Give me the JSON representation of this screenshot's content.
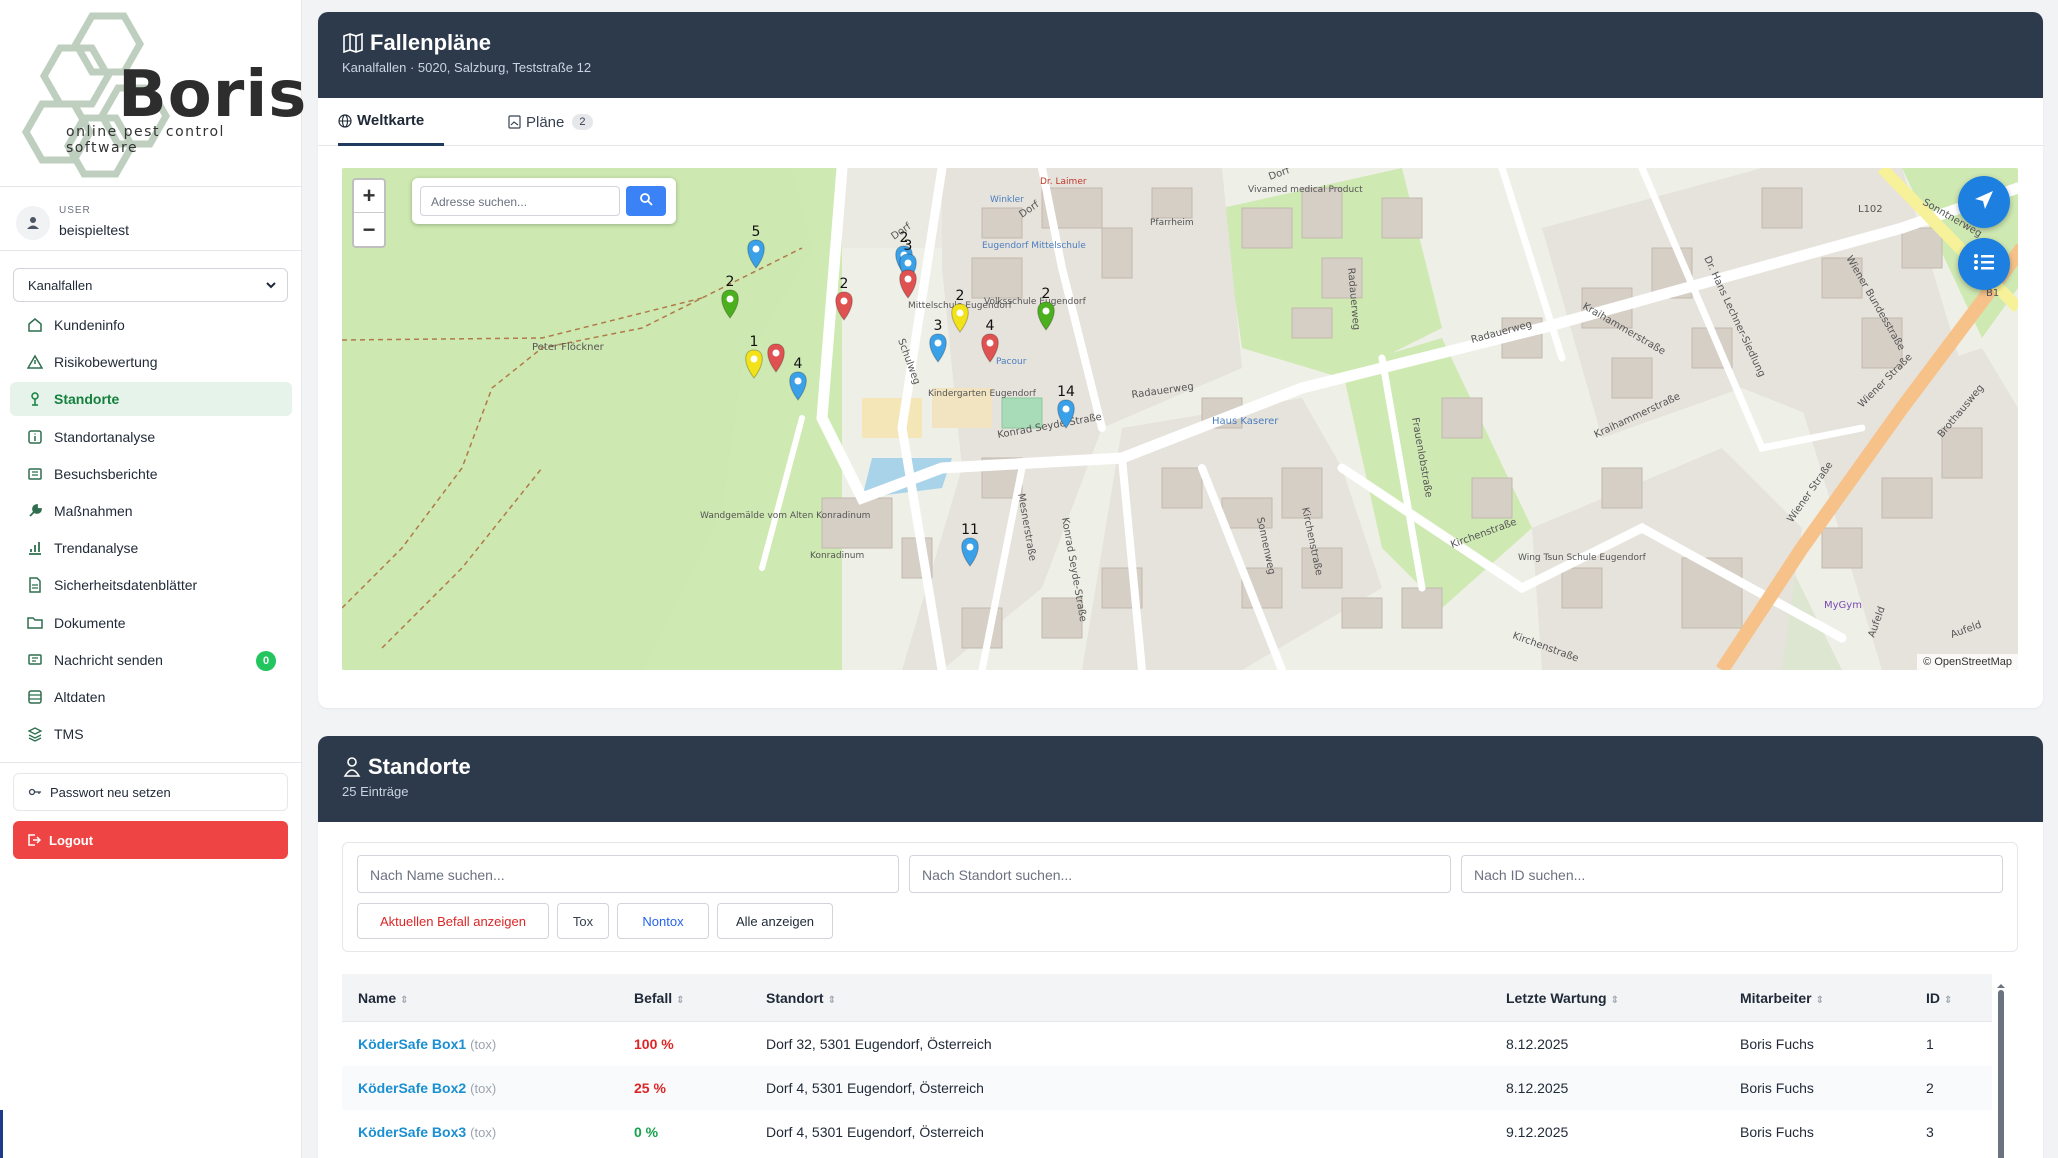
{
  "brand": {
    "name": "Boris",
    "tagline": "online pest control software"
  },
  "user": {
    "label": "USER",
    "name": "beispieltest"
  },
  "location_select": {
    "value": "Kanalfallen"
  },
  "nav": [
    {
      "label": "Kundeninfo",
      "icon": "home-icon"
    },
    {
      "label": "Risikobewertung",
      "icon": "warning-icon"
    },
    {
      "label": "Standorte",
      "icon": "person-pin-icon",
      "active": true
    },
    {
      "label": "Standortanalyse",
      "icon": "info-square-icon"
    },
    {
      "label": "Besuchsberichte",
      "icon": "list-icon"
    },
    {
      "label": "Maßnahmen",
      "icon": "wrench-icon"
    },
    {
      "label": "Trendanalyse",
      "icon": "bar-chart-icon"
    },
    {
      "label": "Sicherheitsdatenblätter",
      "icon": "document-icon"
    },
    {
      "label": "Dokumente",
      "icon": "folder-icon"
    },
    {
      "label": "Nachricht senden",
      "icon": "message-icon",
      "badge": "0"
    },
    {
      "label": "Altdaten",
      "icon": "archive-icon"
    },
    {
      "label": "TMS",
      "icon": "stack-icon"
    }
  ],
  "password_button": "Passwort neu setzen",
  "logout_button": "Logout",
  "fallenplaene": {
    "title": "Fallenpläne",
    "subtitle": "Kanalfallen · 5020, Salzburg, Teststraße 12",
    "tabs": [
      {
        "label": "Weltkarte",
        "active": true
      },
      {
        "label": "Pläne",
        "count": "2"
      }
    ],
    "map": {
      "search_placeholder": "Adresse suchen...",
      "zoom_in": "+",
      "zoom_out": "−",
      "attribution": "© OpenStreetMap",
      "place_labels": [
        "Peter Flöckner",
        "Dorf",
        "Dorf",
        "Dorf",
        "Schulweg",
        "Konrad Seyde-Straße",
        "Konrad Seyde-Straße",
        "Mesnerstraße",
        "Sonnenweg",
        "Kirchenstraße",
        "Radauerweg",
        "Radauerweg",
        "Radauerweg",
        "Frauenlobstraße",
        "Kraihammerstraße",
        "Kraihammerstraße",
        "Wiener Bundesstraße",
        "Wiener Straße",
        "Wiener Straße",
        "Brothausweg",
        "Kirchenstraße",
        "Kirchenstraße",
        "Aufeld",
        "Aufeld",
        "Sonntnerweg",
        "Dr. Hans Lechner-Siedlung",
        "Wandgemälde vom Alten Konradinum",
        "Konradinum",
        "Haus Kaserer",
        "Pfarrheim",
        "Winkler",
        "Eugendorf Mittelschule",
        "Mittelschule Eugendorf",
        "Volksschule Eugendorf",
        "Kindergarten Eugendorf",
        "Dr. Laimer",
        "Wing Tsun Schule Eugendorf",
        "MyGym",
        "L102",
        "B1",
        "Vivamed medical Product",
        "Pacour"
      ],
      "markers": [
        {
          "num": "5",
          "color": "#3aa0e8"
        },
        {
          "num": "2",
          "color": "#3aa0e8"
        },
        {
          "num": "3",
          "color": "#3aa0e8"
        },
        {
          "num": "",
          "color": "#e05252"
        },
        {
          "num": "2",
          "color": "#4caf1e"
        },
        {
          "num": "2",
          "color": "#e05252"
        },
        {
          "num": "2",
          "color": "#f2e21a"
        },
        {
          "num": "2",
          "color": "#4caf1e"
        },
        {
          "num": "3",
          "color": "#3aa0e8"
        },
        {
          "num": "4",
          "color": "#e05252"
        },
        {
          "num": "1",
          "color": "#f2e21a"
        },
        {
          "num": "",
          "color": "#e05252"
        },
        {
          "num": "4",
          "color": "#3aa0e8"
        },
        {
          "num": "14",
          "color": "#3aa0e8"
        },
        {
          "num": "11",
          "color": "#3aa0e8"
        }
      ]
    }
  },
  "standorte": {
    "title": "Standorte",
    "subtitle": "25 Einträge",
    "filters": {
      "name_placeholder": "Nach Name suchen...",
      "location_placeholder": "Nach Standort suchen...",
      "id_placeholder": "Nach ID suchen..."
    },
    "filter_buttons": [
      "Aktuellen Befall anzeigen",
      "Tox",
      "Nontox",
      "Alle anzeigen"
    ],
    "columns": [
      "Name",
      "Befall",
      "Standort",
      "Letzte Wartung",
      "Mitarbeiter",
      "ID"
    ],
    "rows": [
      {
        "name": "KöderSafe Box1",
        "tag": "(tox)",
        "befall": "100 %",
        "level": "red",
        "standort": "Dorf 32, 5301 Eugendorf, Österreich",
        "wartung": "8.12.2025",
        "mitarbeiter": "Boris Fuchs",
        "id": "1"
      },
      {
        "name": "KöderSafe Box2",
        "tag": "(tox)",
        "befall": "25 %",
        "level": "red",
        "standort": "Dorf 4, 5301 Eugendorf, Österreich",
        "wartung": "8.12.2025",
        "mitarbeiter": "Boris Fuchs",
        "id": "2"
      },
      {
        "name": "KöderSafe Box3",
        "tag": "(tox)",
        "befall": "0 %",
        "level": "green",
        "standort": "Dorf 4, 5301 Eugendorf, Österreich",
        "wartung": "9.12.2025",
        "mitarbeiter": "Boris Fuchs",
        "id": "3"
      }
    ]
  }
}
